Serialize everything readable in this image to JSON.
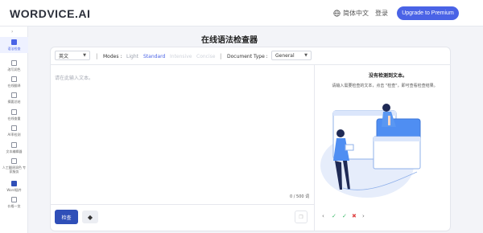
{
  "header": {
    "logo": "WORDVICE.AI",
    "language": "简体中文",
    "login": "登录",
    "upgrade": "Upgrade to Premium"
  },
  "sidebar": {
    "items": [
      {
        "label": "语法检查",
        "icon": "grammar-icon"
      },
      {
        "label": "改写润色",
        "icon": "paraphrase-icon"
      },
      {
        "label": "在线翻译",
        "icon": "translate-icon"
      },
      {
        "label": "摘要总结",
        "icon": "summary-icon"
      },
      {
        "label": "在线查重",
        "icon": "plagiarism-icon"
      },
      {
        "label": "AI率检测",
        "icon": "ai-detect-icon"
      },
      {
        "label": "文本编辑器",
        "icon": "editor-icon"
      },
      {
        "label": "人工翻译润色 专家服务",
        "icon": "expert-icon"
      },
      {
        "label": "Word插件",
        "icon": "word-plugin-icon"
      },
      {
        "label": "价格一览",
        "icon": "pricing-icon"
      }
    ]
  },
  "main": {
    "title": "在线语法检查器",
    "language_select": "英文",
    "modes_label": "Modes :",
    "modes": [
      "Light",
      "Standard",
      "Intensive",
      "Concise"
    ],
    "doc_type_label": "Document Type :",
    "doc_type": "General",
    "placeholder": "请在此输入文本。",
    "counter": "0 / 500 词",
    "check_button": "检查"
  },
  "result": {
    "title": "没有检测到文本。",
    "desc": "请输入需要检查的文本，点击 \"检查\"，即可查看检查结果。"
  },
  "colors": {
    "accent": "#4a63e6",
    "check_button": "#2f4fb8"
  }
}
